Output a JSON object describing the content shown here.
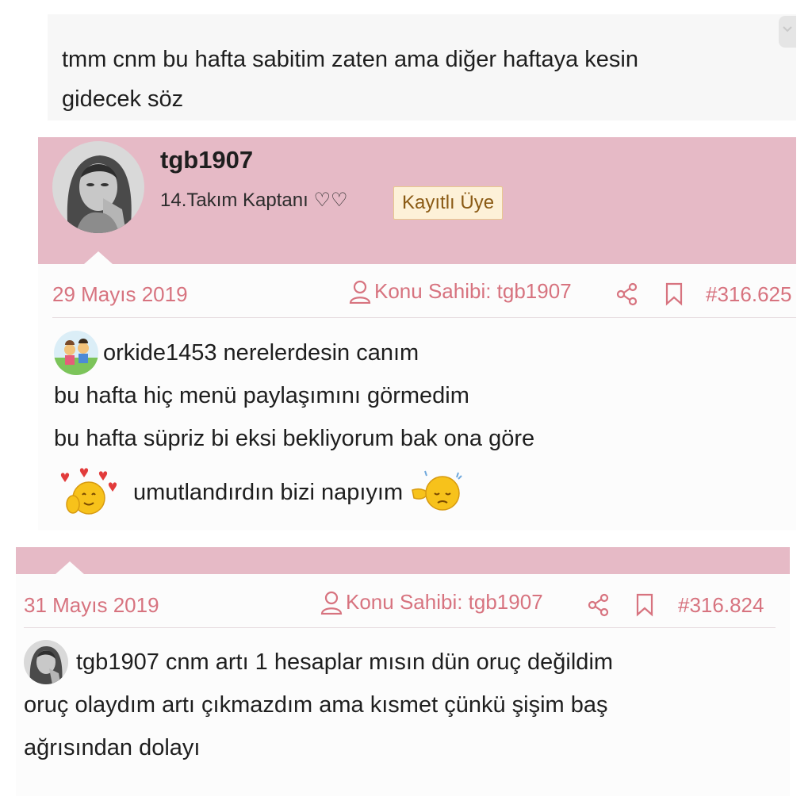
{
  "quote": {
    "text_line1": "tmm cnm bu hafta sabitim zaten ama diğer haftaya kesin",
    "text_line2": "gidecek söz"
  },
  "post1": {
    "username": "tgb1907",
    "user_title": "14.Takım Kaptanı ♡♡",
    "badge": "Kayıtlı Üye",
    "date": "29 Mayıs 2019",
    "owner_label": "Konu Sahibi: tgb1907",
    "post_number": "#316.625",
    "mention": "orkide1453",
    "line1_rest": " nerelerdesin canım",
    "line2": "bu hafta hiç menü paylaşımını görmedim",
    "line3": "bu hafta süpriz bi eksi bekliyorum bak ona göre",
    "line4": "umutlandırdın bizi napıyım"
  },
  "post2": {
    "date": "31 Mayıs 2019",
    "owner_label": "Konu Sahibi: tgb1907",
    "post_number": "#316.824",
    "mention": "tgb1907",
    "line1_rest": " cnm artı 1 hesaplar mısın dün oruç değildim",
    "line2": "oruç olaydım artı çıkmazdım ama kısmet çünkü şişim baş",
    "line3": "ağrısından dolayı"
  },
  "colors": {
    "userbar": "#e6bac6",
    "meta_text": "#d7737f",
    "badge_bg": "#fdf1d8"
  },
  "icons": [
    "user-icon",
    "share-icon",
    "bookmark-icon",
    "chevron-icon"
  ]
}
